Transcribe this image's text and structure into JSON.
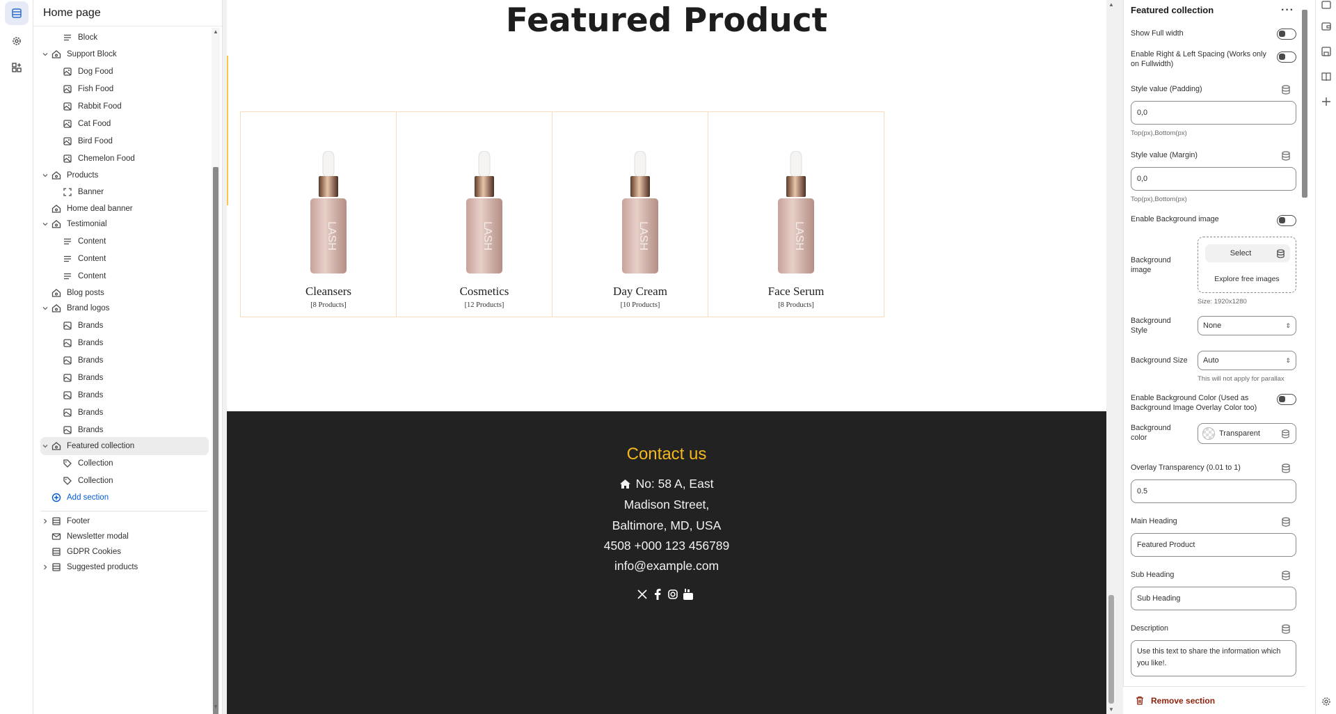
{
  "left_panel": {
    "title": "Home page",
    "tree": [
      {
        "label": "Block",
        "kind": "lines",
        "level": 2,
        "chevron": ""
      },
      {
        "label": "Support Block",
        "kind": "section",
        "level": 1,
        "chevron": "open"
      },
      {
        "label": "Dog Food",
        "kind": "block",
        "level": 2,
        "chevron": ""
      },
      {
        "label": "Fish Food",
        "kind": "block",
        "level": 2,
        "chevron": ""
      },
      {
        "label": "Rabbit Food",
        "kind": "block",
        "level": 2,
        "chevron": ""
      },
      {
        "label": "Cat Food",
        "kind": "block",
        "level": 2,
        "chevron": ""
      },
      {
        "label": "Bird Food",
        "kind": "block",
        "level": 2,
        "chevron": ""
      },
      {
        "label": "Chemelon Food",
        "kind": "block",
        "level": 2,
        "chevron": ""
      },
      {
        "label": "Products",
        "kind": "section",
        "level": 1,
        "chevron": "open"
      },
      {
        "label": "Banner",
        "kind": "frame",
        "level": 2,
        "chevron": ""
      },
      {
        "label": "Home deal banner",
        "kind": "section",
        "level": 1,
        "chevron": ""
      },
      {
        "label": "Testimonial",
        "kind": "section",
        "level": 1,
        "chevron": "open"
      },
      {
        "label": "Content",
        "kind": "lines",
        "level": 2,
        "chevron": ""
      },
      {
        "label": "Content",
        "kind": "lines",
        "level": 2,
        "chevron": ""
      },
      {
        "label": "Content",
        "kind": "lines",
        "level": 2,
        "chevron": ""
      },
      {
        "label": "Blog posts",
        "kind": "section",
        "level": 1,
        "chevron": ""
      },
      {
        "label": "Brand logos",
        "kind": "section",
        "level": 1,
        "chevron": "open"
      },
      {
        "label": "Brands",
        "kind": "image",
        "level": 2,
        "chevron": ""
      },
      {
        "label": "Brands",
        "kind": "image",
        "level": 2,
        "chevron": ""
      },
      {
        "label": "Brands",
        "kind": "image",
        "level": 2,
        "chevron": ""
      },
      {
        "label": "Brands",
        "kind": "image",
        "level": 2,
        "chevron": ""
      },
      {
        "label": "Brands",
        "kind": "image",
        "level": 2,
        "chevron": ""
      },
      {
        "label": "Brands",
        "kind": "image",
        "level": 2,
        "chevron": ""
      },
      {
        "label": "Brands",
        "kind": "image",
        "level": 2,
        "chevron": ""
      },
      {
        "label": "Featured collection",
        "kind": "section",
        "level": 1,
        "chevron": "open",
        "selected": true
      },
      {
        "label": "Collection",
        "kind": "tag",
        "level": 2,
        "chevron": ""
      },
      {
        "label": "Collection",
        "kind": "tag",
        "level": 2,
        "chevron": ""
      },
      {
        "label": "Add section",
        "kind": "add",
        "level": 1,
        "chevron": ""
      }
    ],
    "bottom": [
      {
        "label": "Footer",
        "kind": "grid",
        "chevron": "closed"
      },
      {
        "label": "Newsletter modal",
        "kind": "mail",
        "chevron": ""
      },
      {
        "label": "GDPR Cookies",
        "kind": "grid",
        "chevron": ""
      },
      {
        "label": "Suggested products",
        "kind": "grid",
        "chevron": "closed"
      }
    ]
  },
  "preview": {
    "heading": "Featured Product",
    "products": [
      {
        "name": "Cleansers",
        "count": "[8 Products]"
      },
      {
        "name": "Cosmetics",
        "count": "[12 Products]"
      },
      {
        "name": "Day Cream",
        "count": "[10 Products]"
      },
      {
        "name": "Face Serum",
        "count": "[8 Products]"
      }
    ],
    "bottle_text": "LASH",
    "footer": {
      "heading": "Contact us",
      "lines": [
        "No: 58 A, East",
        "Madison Street,",
        "Baltimore, MD, USA",
        "4508 +000 123 456789",
        "info@example.com"
      ],
      "social": [
        "x-icon",
        "facebook-icon",
        "instagram-icon",
        "youtube-icon"
      ]
    },
    "colors": {
      "accent": "#f5b81c",
      "footer_bg": "#222222",
      "card_border": "#f6dcc1"
    }
  },
  "settings": {
    "title": "Featured collection",
    "show_full_width": "Show Full width",
    "spacing_label": "Enable Right & Left Spacing (Works only on Fullwidth)",
    "padding_label": "Style value (Padding)",
    "padding_value": "0,0",
    "padding_hint": "Top(px),Bottom(px)",
    "margin_label": "Style value (Margin)",
    "margin_value": "0,0",
    "margin_hint": "Top(px),Bottom(px)",
    "bg_image_toggle": "Enable Background image",
    "bg_image_label": "Background image",
    "select_button": "Select",
    "explore_link": "Explore free images",
    "size_hint": "Size: 1920x1280",
    "bg_style_label": "Background Style",
    "bg_style_value": "None",
    "bg_size_label": "Background Size",
    "bg_size_value": "Auto",
    "parallax_hint": "This will not apply for parallax",
    "bg_color_toggle": "Enable Background Color (Used as Background Image Overlay Color too)",
    "bg_color_label": "Background color",
    "bg_color_value": "Transparent",
    "overlay_label": "Overlay Transparency (0.01 to 1)",
    "overlay_value": "0.5",
    "main_heading_label": "Main Heading",
    "main_heading_value": "Featured Product",
    "sub_heading_label": "Sub Heading",
    "sub_heading_value": "Sub Heading",
    "description_label": "Description",
    "description_value": "Use this text to share the information which you like!.",
    "remove_button": "Remove section"
  }
}
